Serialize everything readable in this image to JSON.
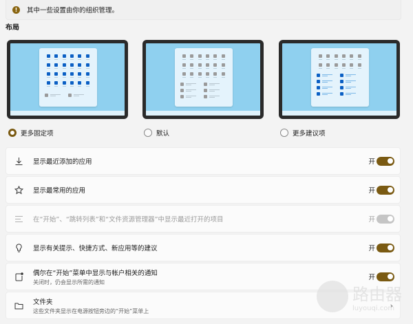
{
  "info_bar": {
    "icon": "info-icon",
    "text": "其中一些设置由你的组织管理。"
  },
  "section_title": "布局",
  "layouts": [
    {
      "label": "更多固定项",
      "selected": true,
      "pin_rows": 4,
      "rec_rows": 1,
      "rec_style": "gray"
    },
    {
      "label": "默认",
      "selected": false,
      "pin_rows": 3,
      "rec_rows": 3,
      "rec_style": "gray"
    },
    {
      "label": "更多建议项",
      "selected": false,
      "pin_rows": 2,
      "rec_rows": 4,
      "rec_style": "blue"
    }
  ],
  "settings": [
    {
      "icon": "download-icon",
      "label": "显示最近添加的应用",
      "state": "开",
      "on": true,
      "disabled": false
    },
    {
      "icon": "star-icon",
      "label": "显示最常用的应用",
      "state": "开",
      "on": true,
      "disabled": false
    },
    {
      "icon": "list-icon",
      "label": "在“开始”、“跳转列表”和“文件资源管理器”中显示最近打开的项目",
      "state": "开",
      "on": true,
      "disabled": true
    },
    {
      "icon": "lightbulb-icon",
      "label": "显示有关提示、快捷方式、新应用等的建议",
      "state": "开",
      "on": true,
      "disabled": false
    },
    {
      "icon": "notification-icon",
      "label": "偶尔在“开始”菜单中显示与帐户相关的通知",
      "sublabel": "关闭时，仍会显示所需的通知",
      "state": "开",
      "on": true,
      "disabled": false
    }
  ],
  "folders": {
    "icon": "folder-icon",
    "label": "文件夹",
    "sublabel": "这些文件夹显示在电源按钮旁边的“开始”菜单上"
  },
  "watermark": {
    "title": "路由器",
    "url": "luyouqi.com"
  },
  "colors": {
    "accent": "#7a5a12",
    "pin_blue": "#0a5fc4",
    "pin_gray": "#9a9a9a"
  }
}
